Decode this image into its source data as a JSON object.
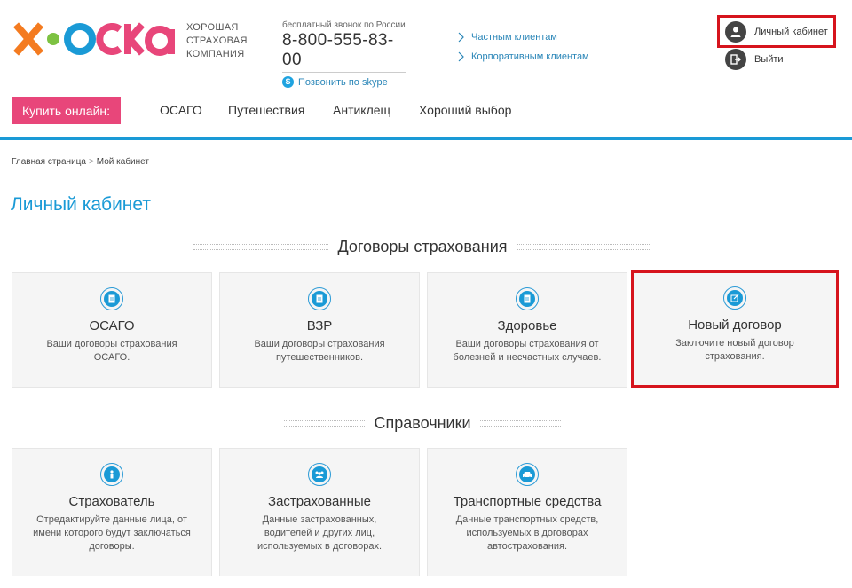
{
  "brand": {
    "logo_text": "ХОСКА",
    "name_lines": [
      "ХОРОШАЯ",
      "СТРАХОВАЯ",
      "КОМПАНИЯ"
    ],
    "colors": {
      "orange": "#f47b20",
      "green": "#7dc242",
      "blue": "#1a9ad6",
      "pink": "#e8467a"
    }
  },
  "contact": {
    "caption": "бесплатный звонок по России",
    "phone": "8-800-555-83-00",
    "skype_label": "Позвонить по skype"
  },
  "client_links": [
    {
      "label": "Частным клиентам"
    },
    {
      "label": "Корпоративным клиентам"
    }
  ],
  "account": {
    "cabinet_label": "Личный кабинет",
    "logout_label": "Выйти"
  },
  "nav": {
    "buy_label": "Купить онлайн:",
    "items": [
      "ОСАГО",
      "Путешествия",
      "Антиклещ",
      "Хороший выбор"
    ]
  },
  "breadcrumb": {
    "home": "Главная страница",
    "separator": ">",
    "current": "Мой кабинет"
  },
  "page": {
    "title": "Личный кабинет"
  },
  "contracts": {
    "heading": "Договоры страхования",
    "cards": [
      {
        "icon": "document-icon",
        "title": "ОСАГО",
        "desc": "Ваши договоры страхования ОСАГО."
      },
      {
        "icon": "document-icon",
        "title": "ВЗР",
        "desc": "Ваши договоры страхования путешественников."
      },
      {
        "icon": "document-icon",
        "title": "Здоровье",
        "desc": "Ваши договоры страхования от болезней и несчастных случаев."
      },
      {
        "icon": "edit-icon",
        "title": "Новый договор",
        "desc": "Заключите новый договор страхования."
      }
    ]
  },
  "directories": {
    "heading": "Справочники",
    "cards": [
      {
        "icon": "person-icon",
        "title": "Страхователь",
        "desc": "Отредактируйте данные лица, от имени которого будут заключаться договоры."
      },
      {
        "icon": "group-icon",
        "title": "Застрахованные",
        "desc": "Данные застрахованных, водителей и других лиц, используемых в договорах."
      },
      {
        "icon": "car-icon",
        "title": "Транспортные средства",
        "desc": "Данные транспортных средств, используемых в договорах автострахования."
      }
    ]
  },
  "highlight_color": "#d6141d"
}
